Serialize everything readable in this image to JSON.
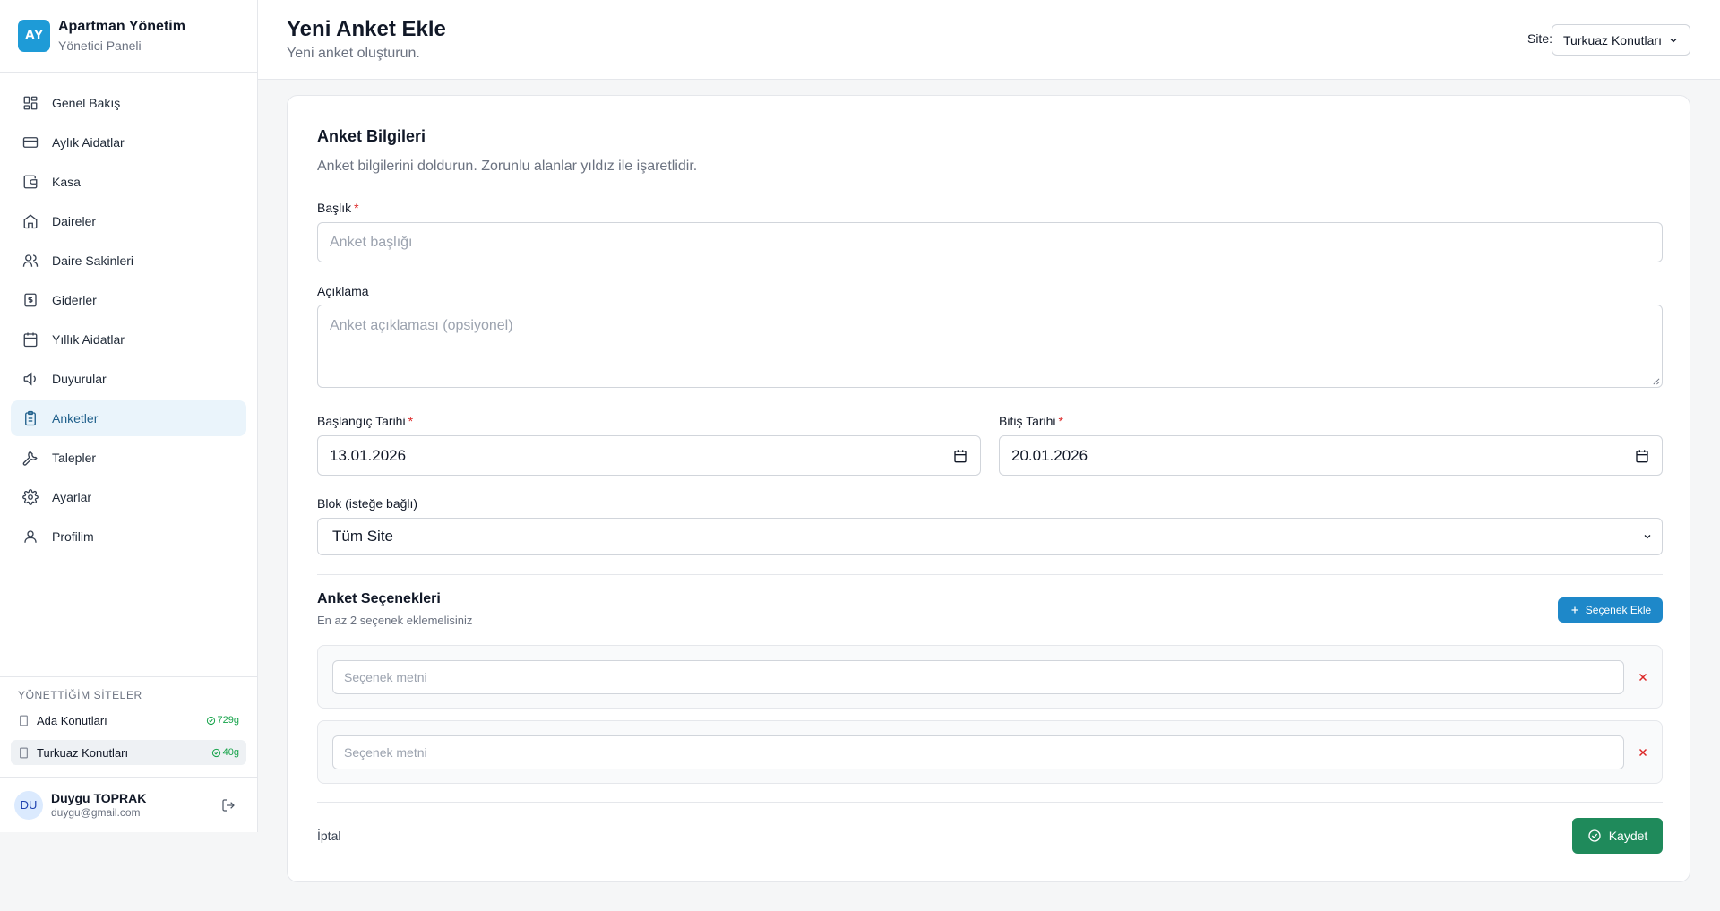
{
  "brand": {
    "logo_text": "AY",
    "title": "Apartman Yönetim",
    "subtitle": "Yönetici Paneli",
    "logo_color": "#1e9bd7"
  },
  "sidebar": {
    "items": [
      {
        "label": "Genel Bakış",
        "icon": "grid-icon"
      },
      {
        "label": "Aylık Aidatlar",
        "icon": "credit-card-icon"
      },
      {
        "label": "Kasa",
        "icon": "wallet-icon"
      },
      {
        "label": "Daireler",
        "icon": "home-icon"
      },
      {
        "label": "Daire Sakinleri",
        "icon": "users-icon"
      },
      {
        "label": "Giderler",
        "icon": "receipt-icon"
      },
      {
        "label": "Yıllık Aidatlar",
        "icon": "calendar-icon"
      },
      {
        "label": "Duyurular",
        "icon": "megaphone-icon"
      },
      {
        "label": "Anketler",
        "icon": "clipboard-icon",
        "active": true
      },
      {
        "label": "Talepler",
        "icon": "wrench-icon"
      },
      {
        "label": "Ayarlar",
        "icon": "gear-icon"
      },
      {
        "label": "Profilim",
        "icon": "user-icon"
      }
    ],
    "active_color": "#eaf4fb"
  },
  "sites": {
    "title": "YÖNETTİĞİM SİTELER",
    "items": [
      {
        "name": "Ada Konutları",
        "days": "729g"
      },
      {
        "name": "Turkuaz Konutları",
        "days": "40g",
        "active": true
      }
    ],
    "days_color": "#16a34a"
  },
  "user": {
    "initials": "DU",
    "name": "Duygu TOPRAK",
    "email": "duygu@gmail.com"
  },
  "header": {
    "title": "Yeni Anket Ekle",
    "subtitle": "Yeni anket oluşturun.",
    "site_label": "Site:",
    "site_value": "Turkuaz Konutları"
  },
  "form": {
    "title": "Anket Bilgileri",
    "description": "Anket bilgilerini doldurun. Zorunlu alanlar yıldız ile işaretlidir.",
    "required_mark": "*",
    "title_label": "Başlık",
    "title_placeholder": "Anket başlığı",
    "description_label": "Açıklama",
    "description_placeholder": "Anket açıklaması (opsiyonel)",
    "start_label": "Başlangıç Tarihi",
    "start_value": "13.01.2026",
    "end_label": "Bitiş Tarihi",
    "end_value": "20.01.2026",
    "block_label": "Blok (isteğe bağlı)",
    "block_value": "Tüm Site"
  },
  "options": {
    "title": "Anket Seçenekleri",
    "subtitle": "En az 2 seçenek eklemelisiniz",
    "add_label": "Seçenek Ekle",
    "placeholder": "Seçenek metni",
    "add_color": "#1e88c9",
    "remove_color": "#dc2626"
  },
  "actions": {
    "cancel_label": "İptal",
    "save_label": "Kaydet",
    "save_color": "#1f8a5b"
  }
}
